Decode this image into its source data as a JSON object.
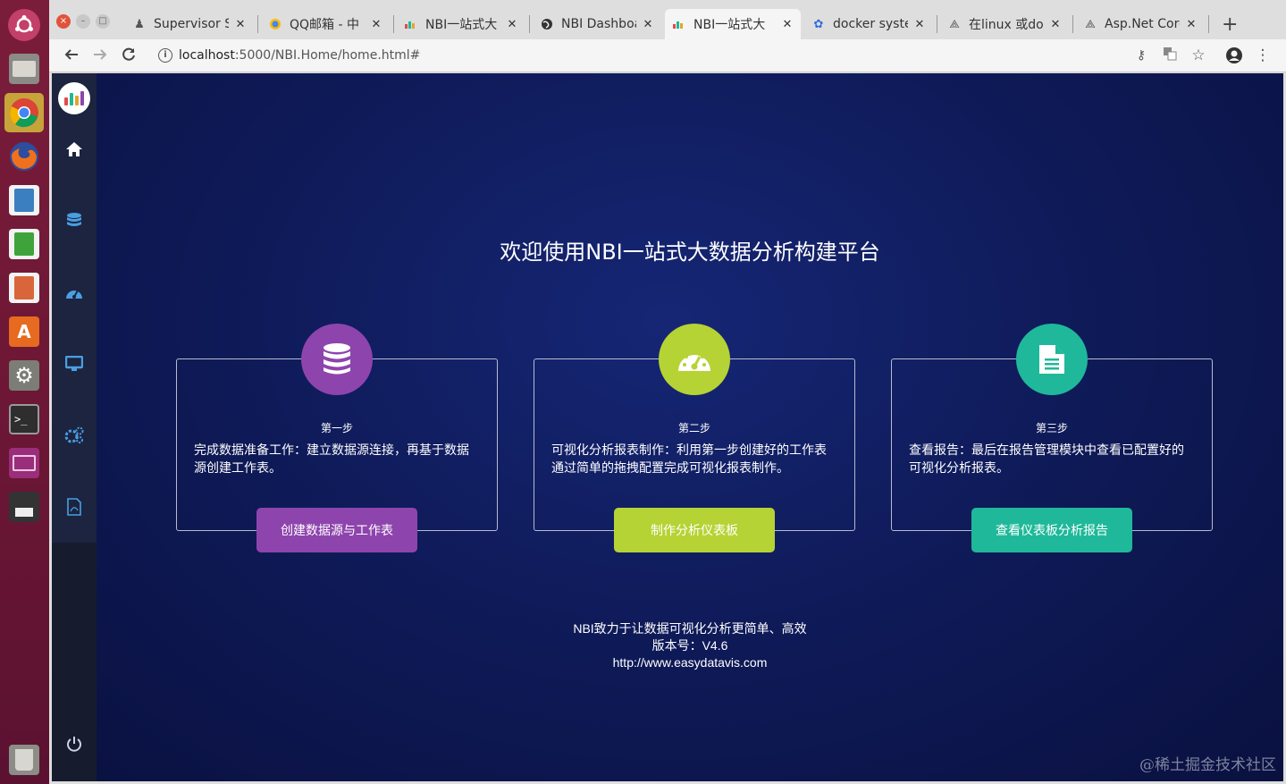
{
  "tabs": [
    {
      "title": "Supervisor S",
      "icon": "supervisor-icon"
    },
    {
      "title": "QQ邮箱 - 中",
      "icon": "qq-mail-icon"
    },
    {
      "title": "NBI一站式大",
      "icon": "nbi-icon"
    },
    {
      "title": "NBI Dashboa",
      "icon": "globe-icon"
    },
    {
      "title": "NBI一站式大",
      "icon": "nbi-icon",
      "active": true
    },
    {
      "title": "docker syste",
      "icon": "baidu-paw-icon"
    },
    {
      "title": "在linux 或do",
      "icon": "juejin-icon"
    },
    {
      "title": "Asp.Net Core",
      "icon": "juejin-icon"
    }
  ],
  "address_bar": {
    "host": "localhost",
    "rest": ":5000/NBI.Home/home.html#"
  },
  "page": {
    "welcome_title": "欢迎使用NBI一站式大数据分析构建平台",
    "steps": [
      {
        "label": "第一步",
        "description": "完成数据准备工作：建立数据源连接，再基于数据源创建工作表。",
        "button": "创建数据源与工作表",
        "color": "#8e44ad",
        "icon": "database-icon"
      },
      {
        "label": "第二步",
        "description": "可视化分析报表制作：利用第一步创建好的工作表通过简单的拖拽配置完成可视化报表制作。",
        "button": "制作分析仪表板",
        "color": "#b5d334",
        "icon": "dashboard-icon"
      },
      {
        "label": "第三步",
        "description": "查看报告：最后在报告管理模块中查看已配置好的可视化分析报表。",
        "button": "查看仪表板分析报告",
        "color": "#1fb89a",
        "icon": "document-icon"
      }
    ],
    "footer": {
      "slogan": "NBI致力于让数据可视化分析更简单、高效",
      "version": "版本号：V4.6",
      "url": "http://www.easydatavis.com"
    }
  },
  "watermark": "@稀土掘金技术社区"
}
